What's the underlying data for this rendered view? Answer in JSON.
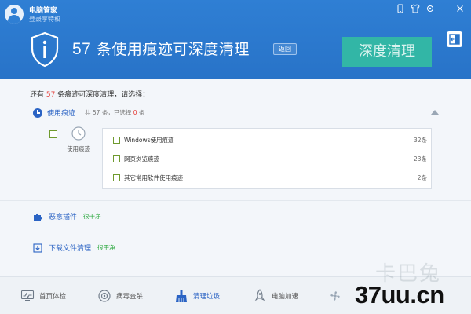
{
  "header": {
    "app_title": "电脑管家",
    "login_link": "登录享特权",
    "count": "57",
    "headline_suffix": " 条使用痕迹可深度清理",
    "back_button": "返回",
    "deep_clean_button": "深度清理"
  },
  "prompt": {
    "prefix": "还有 ",
    "count": "57",
    "suffix": " 条痕迹可深度清理，请选择："
  },
  "usage_section": {
    "title": "使用痕迹",
    "count_prefix": "共 57 条，已选择 ",
    "selected": "0",
    "count_suffix": " 条",
    "group_label": "使用痕迹",
    "items": [
      {
        "label": "Windows使用痕迹",
        "count": "32条"
      },
      {
        "label": "网页浏览痕迹",
        "count": "23条"
      },
      {
        "label": "其它常用软件使用痕迹",
        "count": "2条"
      }
    ]
  },
  "plugins": {
    "title": "恶意插件",
    "status": "很干净"
  },
  "downloads": {
    "title": "下载文件清理",
    "status": "很干净"
  },
  "nav": {
    "items": [
      {
        "label": "首页体检"
      },
      {
        "label": "病毒查杀"
      },
      {
        "label": "清理垃圾"
      },
      {
        "label": "电脑加速"
      }
    ]
  },
  "watermark": {
    "faint": "卡巴兔",
    "main": "37uu.cn"
  },
  "colors": {
    "header_blue": "#2f7fd4",
    "accent_teal": "#32b6a6",
    "link_blue": "#2a63c4",
    "count_red": "#e53a35",
    "ok_green": "#2aa83d"
  }
}
